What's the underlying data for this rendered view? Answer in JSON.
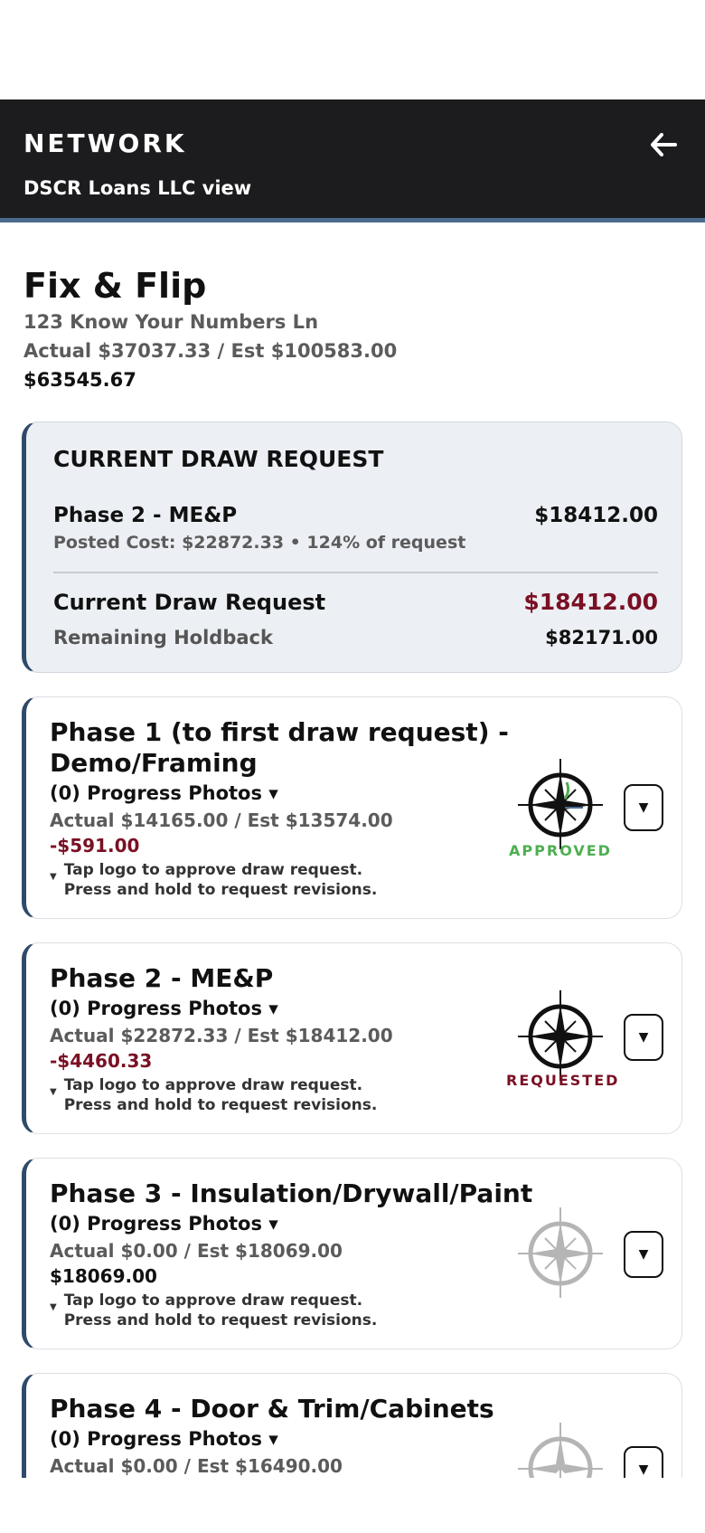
{
  "header": {
    "title": "NETWORK",
    "subtitle": "DSCR Loans LLC view"
  },
  "project": {
    "title": "Fix & Flip",
    "address": "123 Know Your Numbers Ln",
    "actual_vs_est": "Actual $37037.33 / Est $100583.00",
    "total": "$63545.67"
  },
  "draw_request": {
    "heading": "CURRENT DRAW REQUEST",
    "phase_name": "Phase 2 - ME&P",
    "phase_amount": "$18412.00",
    "posted": "Posted Cost: $22872.33 • 124% of request",
    "request_label": "Current Draw Request",
    "request_amount": "$18412.00",
    "holdback_label": "Remaining Holdback",
    "holdback_amount": "$82171.00"
  },
  "phases": [
    {
      "title": "Phase 1 (to first draw request) - Demo/Framing",
      "photos": "(0) Progress Photos ▾",
      "actual": "Actual $14165.00 / Est $13574.00",
      "diff": "-$591.00",
      "hint_line1": "Tap logo to approve draw request.",
      "hint_line2": "Press and hold to request revisions.",
      "status": "APPROVED",
      "status_color": "#4caf50"
    },
    {
      "title": "Phase 2 - ME&P",
      "photos": "(0) Progress Photos ▾",
      "actual": "Actual $22872.33 / Est $18412.00",
      "diff": "-$4460.33",
      "hint_line1": "Tap logo to approve draw request.",
      "hint_line2": "Press and hold to request revisions.",
      "status": "REQUESTED",
      "status_color": "#7a1024"
    },
    {
      "title": "Phase 3 - Insulation/Drywall/Paint",
      "photos": "(0) Progress Photos ▾",
      "actual": "Actual $0.00 / Est $18069.00",
      "diff": "$18069.00",
      "hint_line1": "Tap logo to approve draw request.",
      "hint_line2": "Press and hold to request revisions.",
      "status": "",
      "status_color": "#999999"
    },
    {
      "title": "Phase 4 - Door & Trim/Cabinets",
      "photos": "(0) Progress Photos ▾",
      "actual": "Actual $0.00 / Est $16490.00"
    }
  ],
  "icons": {
    "back": "arrow-left-icon",
    "logo": "compass-logo-icon",
    "dropdown": "triangle-down-icon"
  },
  "colors": {
    "header_bg": "#1c1c1e",
    "accent": "#2f4a6a",
    "negative": "#7a1024",
    "approved": "#4caf50"
  }
}
